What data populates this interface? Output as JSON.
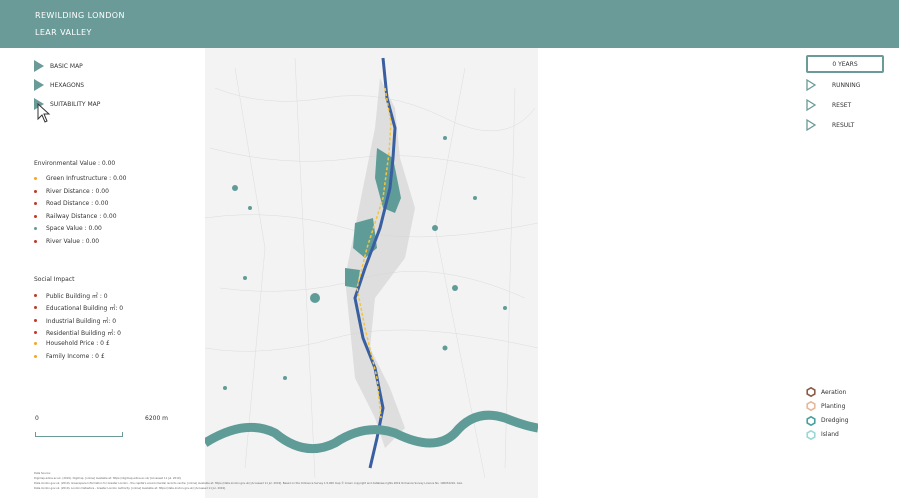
{
  "header": {
    "line1": "REWILDING LONDON",
    "line2": "LEAR VALLEY"
  },
  "map_tabs": [
    {
      "label": "BASIC MAP"
    },
    {
      "label": "HEXAGONS"
    },
    {
      "label": "SUITABILITY MAP"
    }
  ],
  "environmental": {
    "title": "Environmental Value : 0.00",
    "items": [
      {
        "label": "Green Infrustructure : 0.00",
        "color": "#f5a623"
      },
      {
        "label": "River Distance : 0.00",
        "color": "#c0392b"
      },
      {
        "label": "Road Distance : 0.00",
        "color": "#c0392b"
      },
      {
        "label": "Railway Distance : 0.00",
        "color": "#c0392b"
      },
      {
        "label": "Space Value : 0.00",
        "color": "#6a9b98"
      },
      {
        "label": "River Value : 0.00",
        "color": "#c0392b"
      }
    ]
  },
  "social": {
    "title": "Social Impact",
    "items": [
      {
        "label": "Public Building ㎡ : 0",
        "color": "#c0392b"
      },
      {
        "label": "Educational Building ㎡: 0",
        "color": "#c0392b"
      },
      {
        "label": "Industrial Building ㎡: 0",
        "color": "#c0392b"
      },
      {
        "label": "Residential Building ㎡: 0",
        "color": "#c0392b"
      },
      {
        "label": "Household Price : 0 £",
        "color": "#f5a623"
      },
      {
        "label": "Family Income : 0 £",
        "color": "#f5a623"
      }
    ]
  },
  "scale": {
    "min": "0",
    "max": "6200 m"
  },
  "controls": {
    "years": "0 YEARS",
    "running": "RUNNING",
    "reset": "RESET",
    "result": "RESULT"
  },
  "legend": [
    {
      "label": "Aeration",
      "color": "#8b5a4a"
    },
    {
      "label": "Planting",
      "color": "#e8b89a"
    },
    {
      "label": "Dredging",
      "color": "#4aa0a0"
    },
    {
      "label": "Island",
      "color": "#9ad8d8"
    }
  ],
  "colors": {
    "accent": "#6a9b98",
    "river": "#5f9c97",
    "highlight": "#f5c43a",
    "blue": "#3a5fa0"
  },
  "credits": [
    "Data Source:",
    "Digimap.edina.ac.uk. (2019). Digimap. [online] Available at: https://digimap.edina.ac.uk/ [Accessed 11 Jul. 2019].",
    "Data.london.gov.uk. (2019). Greenspace Information for Greater London - the capital's environmental records centre. [online] Available at: https://data.london.gov.uk/ [Accessed 11 Jul. 2019]. Based on the Ordnance Survey 1:5,000 map © Crown copyright and database rights 2019 Ordnance Survey Licence No. 100032216. GLA.",
    "Data.london.gov.uk. (2019). London Datastore - Greater London Authority. [online] Available at: https://data.london.gov.uk/ [Accessed 11 Jul. 2019]."
  ]
}
